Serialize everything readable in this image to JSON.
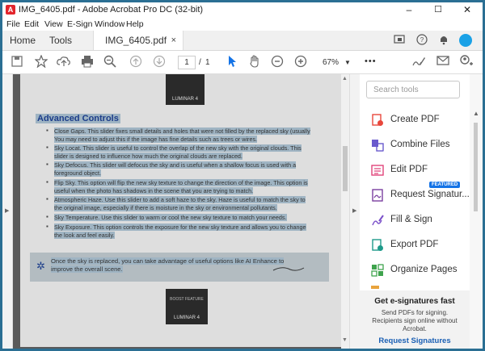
{
  "window": {
    "title": "IMG_6405.pdf - Adobe Acrobat Pro DC (32-bit)",
    "controls": {
      "minimize": "–",
      "maximize": "☐",
      "close": "✕"
    }
  },
  "menu": [
    "File",
    "Edit",
    "View",
    "E-Sign",
    "Window",
    "Help"
  ],
  "tabs": {
    "home": "Home",
    "tools": "Tools",
    "document": "IMG_6405.pdf",
    "close": "×"
  },
  "toolbar": {
    "page_current": "1",
    "page_sep": "/",
    "page_total": "1",
    "zoom": "67%",
    "more": "•••"
  },
  "search": {
    "placeholder": "Search tools"
  },
  "tools": [
    {
      "label": "Create PDF",
      "color": "#e8473c"
    },
    {
      "label": "Combine Files",
      "color": "#6a5acd"
    },
    {
      "label": "Edit PDF",
      "color": "#e0457b"
    },
    {
      "label": "Request Signatur...",
      "color": "#7b3fa0",
      "badge": "FEATURED"
    },
    {
      "label": "Fill & Sign",
      "color": "#7a4fc9"
    },
    {
      "label": "Export PDF",
      "color": "#1e9a8a"
    },
    {
      "label": "Organize Pages",
      "color": "#3fa34d"
    }
  ],
  "esign": {
    "heading": "Get e-signatures fast",
    "desc": "Send PDFs for signing. Recipients sign online without Acrobat.",
    "link": "Request Signatures"
  },
  "page": {
    "heading": "Advanced Controls",
    "lines": [
      "Close Gaps. This slider fixes small details and holes that were not filled by the replaced sky (usually",
      "You may need to adjust this if the image has fine details such as trees or wires.",
      "Sky Locat. This slider is useful to control the overlap of the new sky with the original clouds. This",
      "slider is designed to influence how much the original clouds are replaced.",
      "Sky Defocus. This slider will defocus the sky and is useful when a shallow focus is used with a",
      "foreground object.",
      "Flip Sky. This option will flip the new sky texture to change the direction of the image. This option is",
      "useful when the photo has shadows in the scene that you are trying to match.",
      "Atmospheric Haze. Use this slider to add a soft haze to the sky. Haze is useful to match the sky to",
      "the original image, especially if there is moisture in the sky or environmental pollutants.",
      "Sky Temperature. Use this slider to warm or cool the new sky texture to match your needs.",
      "Sky Exposure. This option controls the exposure for the new sky texture and allows you to change",
      "the look and feel easily."
    ],
    "promo_lines": [
      "Once the sky is replaced, you can take advantage of useful options like AI Enhance to",
      "improve the overall scene."
    ],
    "logo_text": "LUMINAR 4",
    "boost_text": "BOOST FEATURE"
  }
}
